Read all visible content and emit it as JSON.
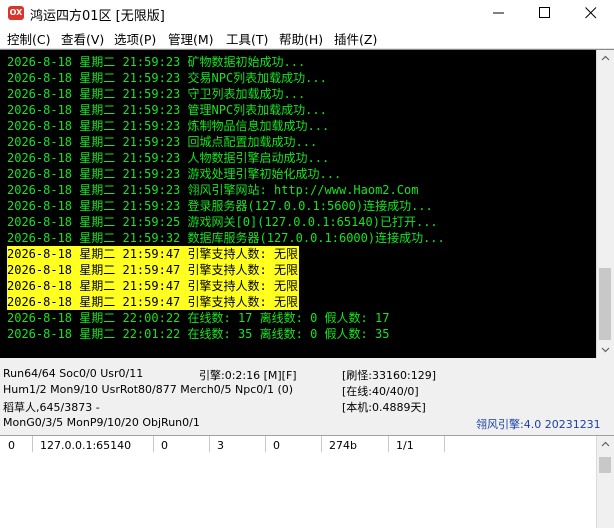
{
  "window": {
    "title": "鸿运四方01区 [无限版]",
    "icon_label": "OX",
    "icon_color": "#d9352a"
  },
  "menu": [
    {
      "label": "控制(C)"
    },
    {
      "label": "查看(V)"
    },
    {
      "label": "选项(P)"
    },
    {
      "label": "管理(M)"
    },
    {
      "label": "工具(T)"
    },
    {
      "label": "帮助(H)"
    },
    {
      "label": "插件(Z)"
    }
  ],
  "console": {
    "text_color": "#14e51f",
    "highlight_color": "#ffff20",
    "lines": [
      {
        "text": "2026-8-18 星期二 21:59:23 矿物数据初始成功...",
        "highlight": false
      },
      {
        "text": "2026-8-18 星期二 21:59:23 交易NPC列表加载成功...",
        "highlight": false
      },
      {
        "text": "2026-8-18 星期二 21:59:23 守卫列表加载成功...",
        "highlight": false
      },
      {
        "text": "2026-8-18 星期二 21:59:23 管理NPC列表加载成功...",
        "highlight": false
      },
      {
        "text": "2026-8-18 星期二 21:59:23 炼制物品信息加载成功...",
        "highlight": false
      },
      {
        "text": "2026-8-18 星期二 21:59:23 回城点配置加载成功...",
        "highlight": false
      },
      {
        "text": "2026-8-18 星期二 21:59:23 人物数据引擎启动成功...",
        "highlight": false
      },
      {
        "text": "2026-8-18 星期二 21:59:23 游戏处理引擎初始化成功...",
        "highlight": false
      },
      {
        "text": "2026-8-18 星期二 21:59:23 翎风引擎网站: http://www.Haom2.Com",
        "highlight": false
      },
      {
        "text": "2026-8-18 星期二 21:59:23 登录服务器(127.0.0.1:5600)连接成功...",
        "highlight": false
      },
      {
        "text": "2026-8-18 星期二 21:59:25 游戏网关[0](127.0.0.1:65140)已打开...",
        "highlight": false
      },
      {
        "text": "2026-8-18 星期二 21:59:32 数据库服务器(127.0.0.1:6000)连接成功...",
        "highlight": false
      },
      {
        "text": "2026-8-18 星期二 21:59:47 引擎支持人数: 无限",
        "highlight": true
      },
      {
        "text": "2026-8-18 星期二 21:59:47 引擎支持人数: 无限",
        "highlight": true
      },
      {
        "text": "2026-8-18 星期二 21:59:47 引擎支持人数: 无限",
        "highlight": true
      },
      {
        "text": "2026-8-18 星期二 21:59:47 引擎支持人数: 无限",
        "highlight": true
      },
      {
        "text": "2026-8-18 星期二 22:00:22 在线数: 17 离线数: 0 假人数: 17",
        "highlight": false
      },
      {
        "text": "2026-8-18 星期二 22:01:22 在线数: 35 离线数: 0 假人数: 35",
        "highlight": false
      }
    ]
  },
  "status": {
    "row1_left": "Run64/64 Soc0/0 Usr0/11",
    "row1_mid": "引擎:0:2:16 [M][F]",
    "row1_right": "[刷怪:33160:129]",
    "row2_left": "Hum1/2 Mon9/10 UsrRot80/877 Merch0/5 Npc0/1 (0)",
    "row2_right": "[在线:40/40/0]",
    "row3_left": "稻草人,645/3873 -",
    "row3_right": "[本机:0.4889天]",
    "row4_left": "MonG0/3/5 MonP9/10/20 ObjRun0/1",
    "row4_right": "翎风引擎:4.0 20231231",
    "engine_color": "#1a3fa8"
  },
  "gate_table": {
    "rows": [
      [
        "0",
        "127.0.0.1:65140",
        "0",
        "3",
        "0",
        "274b",
        "1/1"
      ]
    ]
  }
}
